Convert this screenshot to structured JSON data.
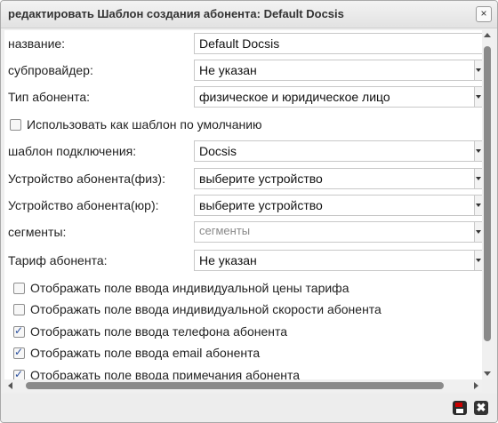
{
  "dialog": {
    "title": "редактировать Шаблон создания абонента: Default Docsis",
    "close_glyph": "×"
  },
  "form": {
    "name": {
      "label": "название:",
      "value": "Default Docsis"
    },
    "subprovider": {
      "label": "субпровайдер:",
      "value": "Не указан"
    },
    "subscriber_type": {
      "label": "Тип абонента:",
      "value": "физическое и юридическое лицо"
    },
    "default_template": {
      "label": "Использовать как шаблон по умолчанию",
      "checked": false
    },
    "connection_template": {
      "label": "шаблон подключения:",
      "value": "Docsis"
    },
    "device_phys": {
      "label": "Устройство абонента(физ):",
      "value": "выберите устройство"
    },
    "device_jur": {
      "label": "Устройство абонента(юр):",
      "value": "выберите устройство"
    },
    "segments": {
      "label": "сегменты:",
      "placeholder": "сегменты"
    },
    "tariff": {
      "label": "Тариф абонента:",
      "value": "Не указан"
    }
  },
  "options": [
    {
      "label": "Отображать поле ввода индивидуальной цены тарифа",
      "checked": false
    },
    {
      "label": "Отображать поле ввода индивидуальной скорости абонента",
      "checked": false
    },
    {
      "label": "Отображать поле ввода телефона абонента",
      "checked": true
    },
    {
      "label": "Отображать поле ввода email абонента",
      "checked": true
    },
    {
      "label": "Отображать поле ввода примечания абонента",
      "checked": true
    }
  ],
  "footer": {
    "save_icon": "save-icon",
    "delete_glyph": "✖"
  }
}
